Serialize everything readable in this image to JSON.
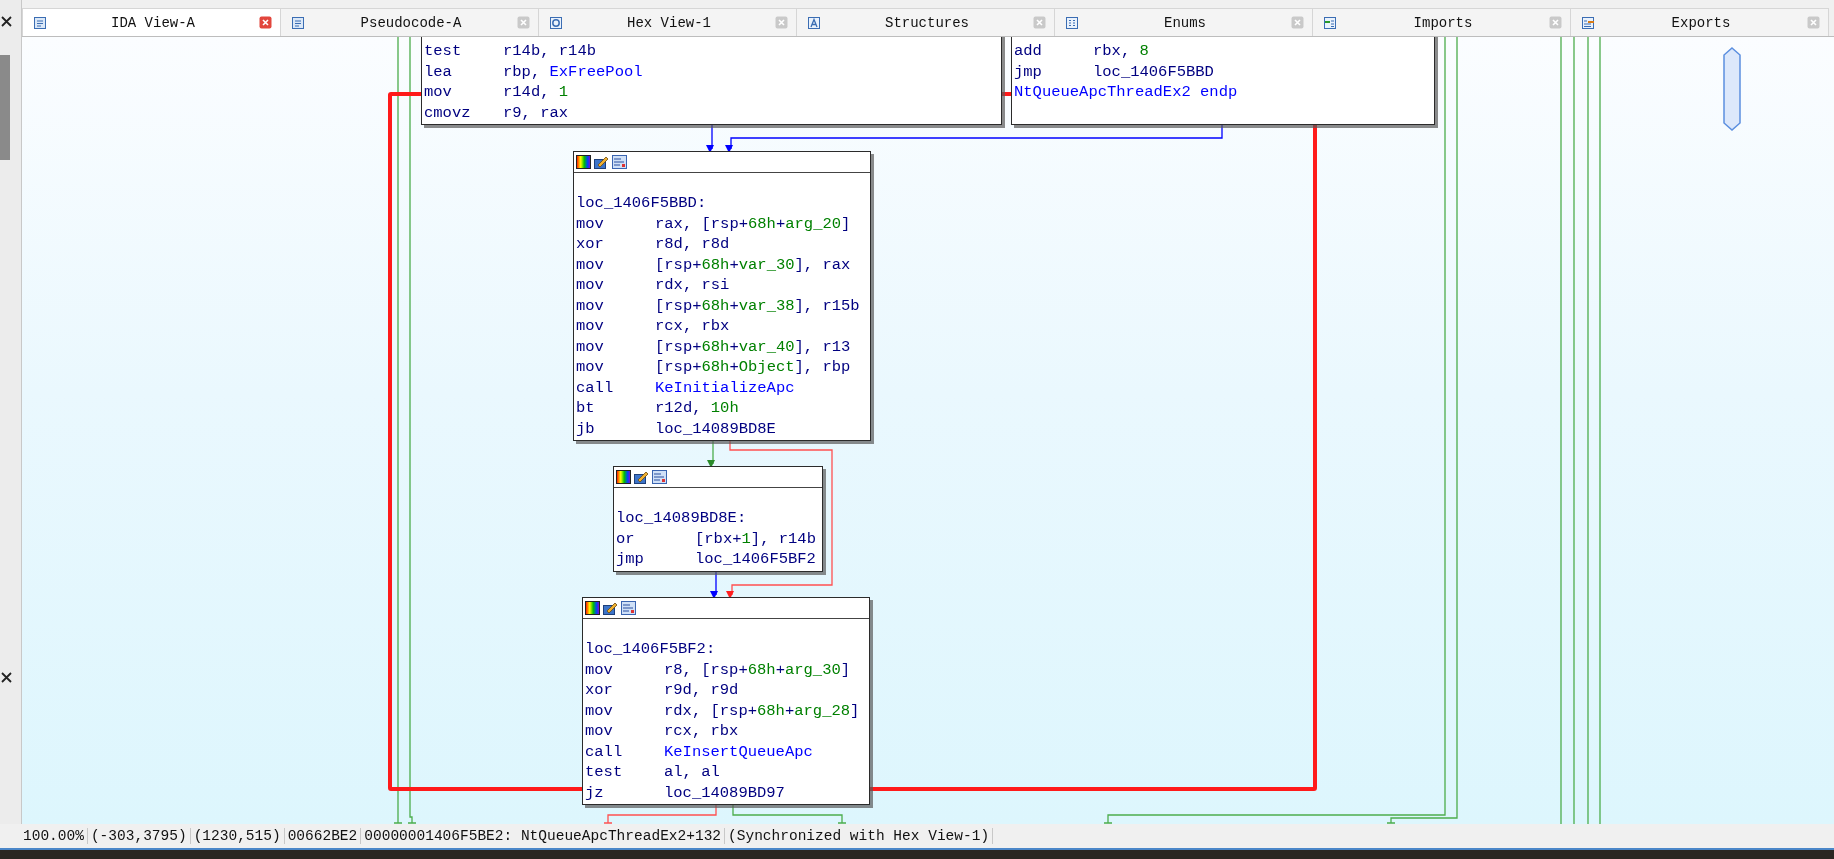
{
  "tabs": [
    {
      "label": "IDA View-A",
      "kind": "graph",
      "selected": true
    },
    {
      "label": "Pseudocode-A",
      "kind": "pseudocode",
      "selected": false
    },
    {
      "label": "Hex View-1",
      "kind": "hex",
      "selected": false
    },
    {
      "label": "Structures",
      "kind": "structures",
      "selected": false
    },
    {
      "label": "Enums",
      "kind": "enums",
      "selected": false
    },
    {
      "label": "Imports",
      "kind": "imports",
      "selected": false
    },
    {
      "label": "Exports",
      "kind": "exports",
      "selected": false
    }
  ],
  "graph": {
    "blocks": [
      {
        "kind": "partial",
        "lines": [
          {
            "kind": "insn",
            "op": "test",
            "args": [
              {
                "t": "r14b, r14b"
              }
            ]
          },
          {
            "kind": "insn",
            "op": "lea",
            "args": [
              {
                "t": "rbp, "
              },
              {
                "t": "ExFreePool",
                "kind": "name"
              }
            ]
          },
          {
            "kind": "insn",
            "op": "mov",
            "args": [
              {
                "t": "r14d, "
              },
              {
                "t": "1",
                "kind": "num"
              }
            ]
          },
          {
            "kind": "insn",
            "op": "cmovz",
            "args": [
              {
                "t": "r9, rax"
              }
            ]
          }
        ]
      },
      {
        "kind": "partial",
        "lines": [
          {
            "kind": "insn",
            "op": "add",
            "args": [
              {
                "t": "rbx, "
              },
              {
                "t": "8",
                "kind": "num"
              }
            ]
          },
          {
            "kind": "insn",
            "op": "jmp",
            "args": [
              {
                "t": "loc_1406F5BBD"
              }
            ]
          },
          {
            "kind": "proc_end",
            "text": "NtQueueApcThreadEx2 endp"
          }
        ]
      },
      {
        "kind": "full",
        "lines": [
          {
            "kind": "label",
            "text": "loc_1406F5BBD:"
          },
          {
            "kind": "insn",
            "op": "mov",
            "args": [
              {
                "t": "rax, [rsp+"
              },
              {
                "t": "68h",
                "kind": "num"
              },
              {
                "t": "+"
              },
              {
                "t": "arg_20",
                "kind": "num"
              },
              {
                "t": "]"
              }
            ]
          },
          {
            "kind": "insn",
            "op": "xor",
            "args": [
              {
                "t": "r8d, r8d"
              }
            ]
          },
          {
            "kind": "insn",
            "op": "mov",
            "args": [
              {
                "t": "[rsp+"
              },
              {
                "t": "68h",
                "kind": "num"
              },
              {
                "t": "+"
              },
              {
                "t": "var_30",
                "kind": "num"
              },
              {
                "t": "], rax"
              }
            ]
          },
          {
            "kind": "insn",
            "op": "mov",
            "args": [
              {
                "t": "rdx, rsi"
              }
            ]
          },
          {
            "kind": "insn",
            "op": "mov",
            "args": [
              {
                "t": "[rsp+"
              },
              {
                "t": "68h",
                "kind": "num"
              },
              {
                "t": "+"
              },
              {
                "t": "var_38",
                "kind": "num"
              },
              {
                "t": "], r15b"
              }
            ]
          },
          {
            "kind": "insn",
            "op": "mov",
            "args": [
              {
                "t": "rcx, rbx"
              }
            ]
          },
          {
            "kind": "insn",
            "op": "mov",
            "args": [
              {
                "t": "[rsp+"
              },
              {
                "t": "68h",
                "kind": "num"
              },
              {
                "t": "+"
              },
              {
                "t": "var_40",
                "kind": "num"
              },
              {
                "t": "], r13"
              }
            ]
          },
          {
            "kind": "insn",
            "op": "mov",
            "args": [
              {
                "t": "[rsp+"
              },
              {
                "t": "68h",
                "kind": "num"
              },
              {
                "t": "+"
              },
              {
                "t": "Object",
                "kind": "num"
              },
              {
                "t": "], rbp"
              }
            ]
          },
          {
            "kind": "insn",
            "op": "call",
            "args": [
              {
                "t": "KeInitializeApc",
                "kind": "name"
              }
            ]
          },
          {
            "kind": "insn",
            "op": "bt",
            "args": [
              {
                "t": "r12d, "
              },
              {
                "t": "10h",
                "kind": "num"
              }
            ]
          },
          {
            "kind": "insn",
            "op": "jb",
            "args": [
              {
                "t": "loc_14089BD8E"
              }
            ]
          }
        ]
      },
      {
        "kind": "full",
        "lines": [
          {
            "kind": "label",
            "text": "loc_14089BD8E:"
          },
          {
            "kind": "insn",
            "op": "or",
            "args": [
              {
                "t": "[rbx+"
              },
              {
                "t": "1",
                "kind": "num"
              },
              {
                "t": "], r14b"
              }
            ]
          },
          {
            "kind": "insn",
            "op": "jmp",
            "args": [
              {
                "t": "loc_1406F5BF2"
              }
            ]
          }
        ]
      },
      {
        "kind": "full",
        "lines": [
          {
            "kind": "label",
            "text": "loc_1406F5BF2:"
          },
          {
            "kind": "insn",
            "op": "mov",
            "args": [
              {
                "t": "r8, [rsp+"
              },
              {
                "t": "68h",
                "kind": "num"
              },
              {
                "t": "+"
              },
              {
                "t": "arg_30",
                "kind": "num"
              },
              {
                "t": "]"
              }
            ]
          },
          {
            "kind": "insn",
            "op": "xor",
            "args": [
              {
                "t": "r9d, r9d"
              }
            ]
          },
          {
            "kind": "insn",
            "op": "mov",
            "args": [
              {
                "t": "rdx, [rsp+"
              },
              {
                "t": "68h",
                "kind": "num"
              },
              {
                "t": "+"
              },
              {
                "t": "arg_28",
                "kind": "num"
              },
              {
                "t": "]"
              }
            ]
          },
          {
            "kind": "insn",
            "op": "mov",
            "args": [
              {
                "t": "rcx, rbx"
              }
            ]
          },
          {
            "kind": "insn",
            "op": "call",
            "args": [
              {
                "t": "KeInsertQueueApc",
                "kind": "name"
              }
            ]
          },
          {
            "kind": "insn",
            "op": "test",
            "args": [
              {
                "t": "al, al"
              }
            ]
          },
          {
            "kind": "insn",
            "op": "jz",
            "args": [
              {
                "t": "loc_14089BD97"
              }
            ]
          }
        ]
      }
    ]
  },
  "status_bar": [
    "100.00%",
    "(-303,3795)",
    "(1230,515)",
    "00662BE2",
    "00000001406F5BE2: NtQueueApcThreadEx2+132",
    "(Synchronized with Hex View-1)"
  ]
}
